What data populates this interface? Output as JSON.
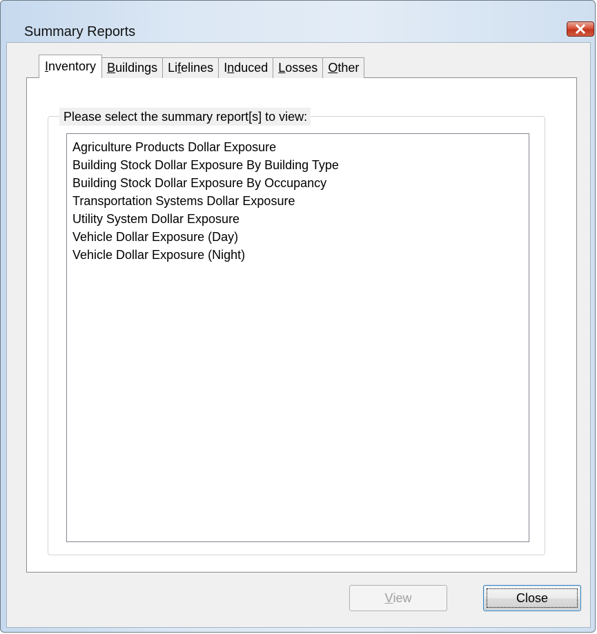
{
  "window": {
    "title": "Summary Reports"
  },
  "tabs": [
    {
      "prefix": "",
      "accel": "I",
      "rest": "nventory",
      "active": true
    },
    {
      "prefix": "",
      "accel": "B",
      "rest": "uildings",
      "active": false
    },
    {
      "prefix": "Li",
      "accel": "f",
      "rest": "elines",
      "active": false
    },
    {
      "prefix": "I",
      "accel": "n",
      "rest": "duced",
      "active": false
    },
    {
      "prefix": "",
      "accel": "L",
      "rest": "osses",
      "active": false
    },
    {
      "prefix": "",
      "accel": "O",
      "rest": "ther",
      "active": false
    }
  ],
  "group": {
    "legend": "Please select the summary report[s] to view:"
  },
  "reports": [
    "Agriculture Products Dollar Exposure",
    "Building Stock Dollar Exposure By Building Type",
    "Building Stock Dollar Exposure By Occupancy",
    "Transportation Systems Dollar Exposure",
    "Utility System Dollar Exposure",
    "Vehicle Dollar Exposure (Day)",
    "Vehicle Dollar Exposure (Night)"
  ],
  "buttons": {
    "view_accel": "V",
    "view_rest": "iew",
    "view_enabled": false,
    "close_label": "Close"
  },
  "icons": {
    "close": "close-x-icon"
  }
}
